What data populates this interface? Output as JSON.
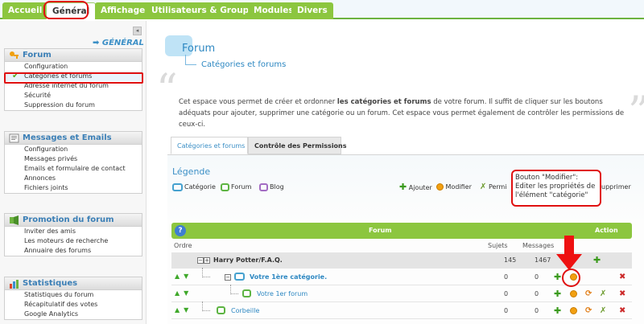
{
  "top_tabs": [
    {
      "label": "Accueil"
    },
    {
      "label": "Général"
    },
    {
      "label": "Affichage"
    },
    {
      "label": "Utilisateurs & Groupes"
    },
    {
      "label": "Modules"
    },
    {
      "label": "Divers"
    }
  ],
  "sidebar": {
    "collapse_icon": "◂",
    "heading": "➡ GÉNÉRAL",
    "sections": [
      {
        "title": "Forum",
        "items": [
          "Configuration",
          "Catégories et forums",
          "Adresse internet du forum",
          "Sécurité",
          "Suppression du forum"
        ]
      },
      {
        "title": "Messages et Emails",
        "items": [
          "Configuration",
          "Messages privés",
          "Emails et formulaire de contact",
          "Annonces",
          "Fichiers joints"
        ]
      },
      {
        "title": "Promotion du forum",
        "items": [
          "Inviter des amis",
          "Les moteurs de recherche",
          "Annuaire des forums"
        ]
      },
      {
        "title": "Statistiques",
        "items": [
          "Statistiques du forum",
          "Récapitulatif des votes",
          "Google Analytics"
        ]
      }
    ]
  },
  "header": {
    "title": "Forum",
    "subtitle": "Catégories et forums"
  },
  "intro": {
    "before": "Cet espace vous permet de créer et ordonner ",
    "bold": "les catégories et forums",
    "after": " de votre forum. Il suffit de cliquer sur les boutons adéquats pour ajouter, supprimer une catégorie ou un forum. Cet espace vous permet également de contrôler les permissions de ceux-ci."
  },
  "subtabs": [
    "Catégories et forums",
    "Contrôle des Permissions"
  ],
  "legend": {
    "title": "Légende",
    "types": [
      "Catégorie",
      "Forum",
      "Blog"
    ],
    "actions": {
      "add": "Ajouter",
      "edit": "Modifier",
      "perm": "Permi",
      "delete": "upprimer"
    }
  },
  "callout": "Bouton \"Modifier\": Editer les propriétés de l'élément \"catégorie\"",
  "table": {
    "header_forum": "Forum",
    "header_action": "Action",
    "col_order": "Ordre",
    "col_subjects": "Sujets",
    "col_messages": "Messages",
    "rows": [
      {
        "name": "Harry Potter/F.A.Q.",
        "subjects": "145",
        "messages": "1467"
      },
      {
        "name": "Votre 1ère catégorie.",
        "subjects": "0",
        "messages": "0"
      },
      {
        "name": "Votre 1er forum",
        "subjects": "0",
        "messages": "0"
      },
      {
        "name": "Corbeille",
        "subjects": "0",
        "messages": "0"
      }
    ]
  },
  "colors": {
    "green": "#8cc63f",
    "blue": "#2e88c2",
    "red_annotation": "#e01010"
  }
}
